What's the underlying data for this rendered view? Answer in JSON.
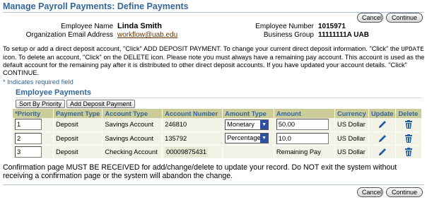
{
  "page": {
    "title": "Manage Payroll Payments: Define Payments",
    "cancel_label": "Cancel",
    "continue_label": "Continue"
  },
  "employee": {
    "name_label": "Employee Name",
    "name": "Linda Smith",
    "email_label": "Organization Email Address",
    "email": "workflow@uab.edu",
    "number_label": "Employee Number",
    "number": "1015971",
    "group_label": "Business Group",
    "group": "11111111A UAB"
  },
  "instructions": {
    "part1": "To setup or add a direct deposit account, \"Click\" ADD DEPOSIT PAYMENT. To change your current direct deposit information. \"Click\" the",
    "update_word": "UPDATE",
    "part2": " icon. To delete an account, \"Click\" on the DELETE icon. Please note you must always have a remaining pay account. This account is used as the default account for the remaining pay after it is distributed to other direct deposit accounts. If you have updated your account details. \"Click\" CONTINUE."
  },
  "required_note": "* Indicates required field",
  "section": {
    "title": "Employee Payments",
    "sort_label": "Sort By Priority",
    "add_label": "Add Deposit Payment"
  },
  "table": {
    "headers": {
      "priority": "*Priority",
      "payment_type": "Payment Type",
      "account_type": "Account Type",
      "account_number": "Account Number",
      "amount_type": "Amount Type",
      "amount": "Amount",
      "currency": "Currency",
      "update": "Update",
      "delete": "Delete"
    },
    "rows": [
      {
        "priority": "1",
        "payment_type": "Deposit",
        "account_type": "Savings Account",
        "account_number": "246810",
        "amount_type": "Monetary",
        "amount": "50.00",
        "currency": "US Dollar"
      },
      {
        "priority": "2",
        "payment_type": "Deposit",
        "account_type": "Savings Account",
        "account_number": "135792",
        "amount_type": "Percentage",
        "amount": "10.0",
        "currency": "US Dollar"
      },
      {
        "priority": "3",
        "payment_type": "Deposit",
        "account_type": "Checking Account",
        "account_number": "00009875431",
        "amount_type": "",
        "amount": "Remaining Pay",
        "currency": "US Dollar"
      }
    ]
  },
  "footer": {
    "note": "Confirmation page MUST BE RECEIVED for add/change/delete to update your record. Do NOT exit the system without receiving a confirmation page or the system will abandon the change."
  },
  "icons": {
    "update": "pencil-icon",
    "delete": "trash-icon",
    "select_arrow": "chevron-down-icon"
  },
  "colors": {
    "title": "#336699",
    "header_bg": "#cccc99",
    "row_bg": "#f2f2e6",
    "link": "#663300",
    "icon_blue": "#1f5fa8"
  }
}
